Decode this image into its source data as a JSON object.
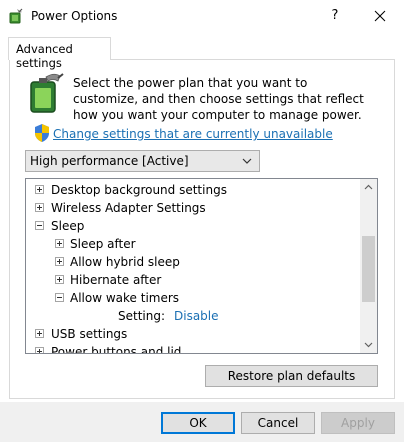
{
  "window": {
    "title": "Power Options",
    "help_glyph": "?",
    "app_icon": "power-options-icon",
    "close_icon": "close-icon"
  },
  "tabs": [
    {
      "label": "Advanced settings",
      "active": true
    }
  ],
  "description": "Select the power plan that you want to customize, and then choose settings that reflect how you want your computer to manage power.",
  "change_link": {
    "label": "Change settings that are currently unavailable",
    "icon": "uac-shield-icon"
  },
  "plan_select": {
    "value": "High performance [Active]"
  },
  "tree": {
    "items": [
      {
        "label": "Desktop background settings",
        "level": 0,
        "expanded": false
      },
      {
        "label": "Wireless Adapter Settings",
        "level": 0,
        "expanded": false
      },
      {
        "label": "Sleep",
        "level": 0,
        "expanded": true
      },
      {
        "label": "Sleep after",
        "level": 1,
        "expanded": false
      },
      {
        "label": "Allow hybrid sleep",
        "level": 1,
        "expanded": false
      },
      {
        "label": "Hibernate after",
        "level": 1,
        "expanded": false
      },
      {
        "label": "Allow wake timers",
        "level": 1,
        "expanded": true
      },
      {
        "label": "USB settings",
        "level": 0,
        "expanded": false
      },
      {
        "label": "Power buttons and lid",
        "level": 0,
        "expanded": false
      }
    ],
    "setting": {
      "label": "Setting:",
      "value": "Disable"
    }
  },
  "buttons": {
    "restore": "Restore plan defaults",
    "ok": "OK",
    "cancel": "Cancel",
    "apply": "Apply"
  },
  "colors": {
    "link": "#1a6fb3",
    "focus": "#0078d7"
  }
}
